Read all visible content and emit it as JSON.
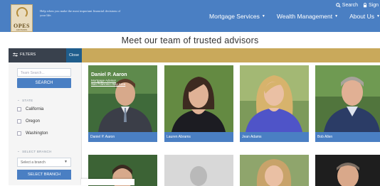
{
  "header": {
    "logo_text": "OPES",
    "logo_sub": "ADVISORS",
    "tagline": "Help when you make the most important financial decisions of your life.",
    "util": {
      "search": "Search",
      "sign": "Sign"
    },
    "nav": [
      "Mortgage Services",
      "Wealth Management",
      "About Us"
    ]
  },
  "page": {
    "title": "Meet our team of trusted advisors"
  },
  "filterbar": {
    "filters_label": "FILTERS",
    "close_label": "Close"
  },
  "sidebar": {
    "search_placeholder": "Team Search...",
    "search_button": "SEARCH",
    "state_heading": "STATE",
    "states": [
      "California",
      "Oregon",
      "Washington"
    ],
    "branch_heading": "SELECT BRANCH",
    "branch_selected": "Select a branch",
    "branch_button": "SELECT BRANCH"
  },
  "advisors": [
    {
      "name": "Daniel P. Aaron",
      "overlay_name": "Daniel P. Aaron",
      "role": "Mortgage Advisor",
      "location": "San Francisco Bay Area"
    },
    {
      "name": "Lauren Abrams"
    },
    {
      "name": "Jean Adams"
    },
    {
      "name": "Bob Allen"
    }
  ],
  "colors": {
    "brand_blue": "#4a7fc3",
    "gold": "#c9a95b",
    "dark": "#39414d"
  }
}
